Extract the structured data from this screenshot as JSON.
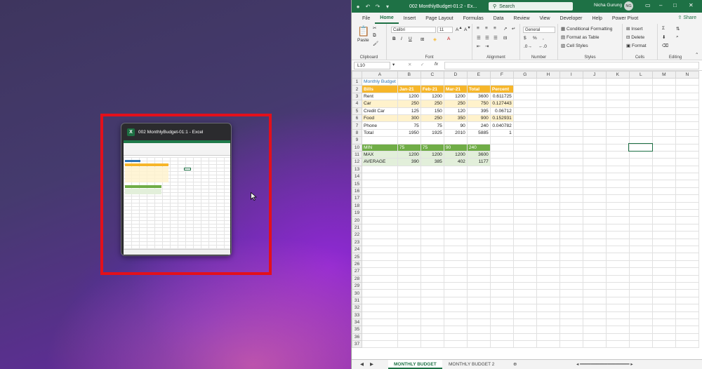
{
  "snap_window": {
    "title": "002 MonthlyBudget-01:1 - Excel"
  },
  "excel": {
    "doc_title": "002 MonthlyBudget-01:2 - Ex...",
    "search_placeholder": "Search",
    "user_name": "Nicha Gurung",
    "user_initials": "NG",
    "menu": [
      "File",
      "Home",
      "Insert",
      "Page Layout",
      "Formulas",
      "Data",
      "Review",
      "View",
      "Developer",
      "Help",
      "Power Pivot"
    ],
    "share": "Share",
    "ribbon": {
      "clipboard_label": "Clipboard",
      "paste": "Paste",
      "font_label": "Font",
      "font_name": "Calibri",
      "font_size": "11",
      "alignment_label": "Alignment",
      "number_label": "Number",
      "number_format": "General",
      "styles_label": "Styles",
      "conditional_formatting": "Conditional Formatting",
      "format_as_table": "Format as Table",
      "cell_styles": "Cell Styles",
      "cells_label": "Cells",
      "insert": "Insert",
      "delete": "Delete",
      "format": "Format",
      "editing_label": "Editing"
    },
    "name_box": "L10",
    "columns": [
      "A",
      "B",
      "C",
      "D",
      "E",
      "F",
      "G",
      "H",
      "I",
      "J",
      "K",
      "L",
      "M",
      "N"
    ],
    "sheet": {
      "title": "Monthly Budget",
      "headers": [
        "Bills",
        "Jan-21",
        "Feb-21",
        "Mar-21",
        "Total",
        "Percent"
      ],
      "rows": [
        [
          "Rent",
          "1200",
          "1200",
          "1200",
          "3600",
          "0.611725"
        ],
        [
          "Car",
          "250",
          "250",
          "250",
          "750",
          "0.127443"
        ],
        [
          "Credit Car",
          "125",
          "150",
          "120",
          "395",
          "0.06712"
        ],
        [
          "Food",
          "300",
          "250",
          "350",
          "900",
          "0.152931"
        ],
        [
          "Phone",
          "75",
          "75",
          "90",
          "240",
          "0.040782"
        ],
        [
          "Total",
          "1950",
          "1925",
          "2010",
          "5885",
          "1"
        ]
      ],
      "stats": [
        [
          "MIN",
          "75",
          "75",
          "90",
          "240"
        ],
        [
          "MAX",
          "1200",
          "1200",
          "1200",
          "3600"
        ],
        [
          "AVERAGE",
          "390",
          "385",
          "402",
          "1177"
        ]
      ]
    },
    "tabs": [
      "MONTHLY BUDGET",
      "MONTHLY BUDGET 2"
    ]
  }
}
